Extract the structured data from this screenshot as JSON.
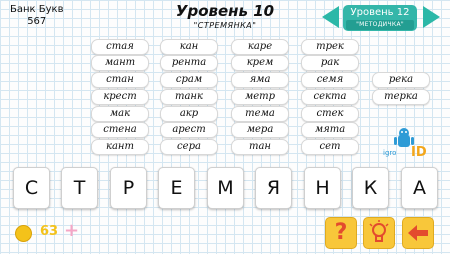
{
  "bank": {
    "label": "Банк Букв",
    "count": "567"
  },
  "level": {
    "title": "Уровень 10",
    "word": "\"СТРЕМЯНКА\""
  },
  "level_nav": {
    "label": "Уровень 12",
    "name": "\"МЕТОДИЧКА\"",
    "prev_icon": "arrow-left-icon",
    "next_icon": "arrow-right-icon"
  },
  "found_words": [
    "стая",
    "кан",
    "каре",
    "трек",
    "мант",
    "рента",
    "крем",
    "рак",
    "стан",
    "срам",
    "яма",
    "семя",
    "река",
    "крест",
    "танк",
    "метр",
    "секта",
    "терка",
    "мак",
    "акр",
    "тема",
    "стек",
    "стена",
    "арест",
    "мера",
    "мята",
    "кант",
    "сера",
    "тан",
    "сет"
  ],
  "tiles": [
    "С",
    "Т",
    "Р",
    "Е",
    "М",
    "Я",
    "Н",
    "К",
    "А"
  ],
  "logo_text": "igroID",
  "coins": {
    "count": "63",
    "add_icon": "plus-icon"
  },
  "buttons": {
    "hint": "?",
    "idea_icon": "lightbulb-icon",
    "back_icon": "back-arrow-icon"
  },
  "colors": {
    "accent": "#34b6a9",
    "button": "#f8c73a",
    "coin": "#f4c21a"
  }
}
